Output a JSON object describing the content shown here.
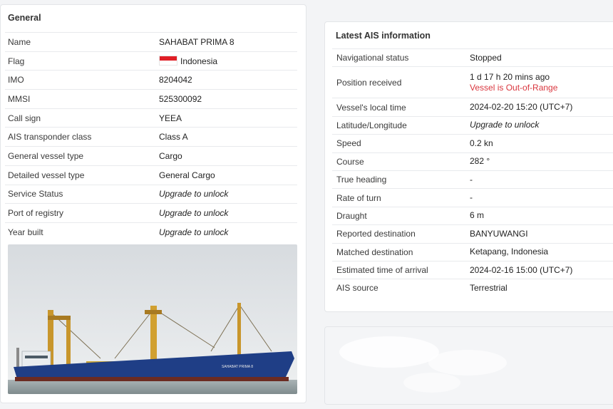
{
  "general": {
    "title": "General",
    "rows": [
      {
        "label": "Name",
        "value": "SAHABAT PRIMA 8"
      },
      {
        "label": "Flag",
        "value": "Indonesia",
        "icon": "indonesia-flag-icon"
      },
      {
        "label": "IMO",
        "value": "8204042"
      },
      {
        "label": "MMSI",
        "value": "525300092"
      },
      {
        "label": "Call sign",
        "value": "YEEA"
      },
      {
        "label": "AIS transponder class",
        "value": "Class A"
      },
      {
        "label": "General vessel type",
        "value": "Cargo"
      },
      {
        "label": "Detailed vessel type",
        "value": "General Cargo"
      },
      {
        "label": "Service Status",
        "value": "Upgrade to unlock"
      },
      {
        "label": "Port of registry",
        "value": "Upgrade to unlock"
      },
      {
        "label": "Year built",
        "value": "Upgrade to unlock"
      }
    ],
    "photo_caption": "SAHABAT PRIMA 8"
  },
  "ais": {
    "title": "Latest AIS information",
    "rows": [
      {
        "label": "Navigational status",
        "value": "Stopped"
      },
      {
        "label": "Position received",
        "value": "1 d 17 h 20 mins ago",
        "note": "Vessel is Out-of-Range"
      },
      {
        "label": "Vessel's local time",
        "value": "2024-02-20 15:20 (UTC+7)"
      },
      {
        "label": "Latitude/Longitude",
        "value": "Upgrade to unlock"
      },
      {
        "label": "Speed",
        "value": "0.2 kn"
      },
      {
        "label": "Course",
        "value": "282 °"
      },
      {
        "label": "True heading",
        "value": "-"
      },
      {
        "label": "Rate of turn",
        "value": "-"
      },
      {
        "label": "Draught",
        "value": "6 m"
      },
      {
        "label": "Reported destination",
        "value": "BANYUWANGI"
      },
      {
        "label": "Matched destination",
        "value": "Ketapang, Indonesia"
      },
      {
        "label": "Estimated time of arrival",
        "value": "2024-02-16 15:00 (UTC+7)"
      },
      {
        "label": "AIS source",
        "value": "Terrestrial"
      }
    ]
  },
  "colors": {
    "warning": "#d9363e",
    "locked": "#b5b7bb",
    "hull": "#1f3e86"
  }
}
